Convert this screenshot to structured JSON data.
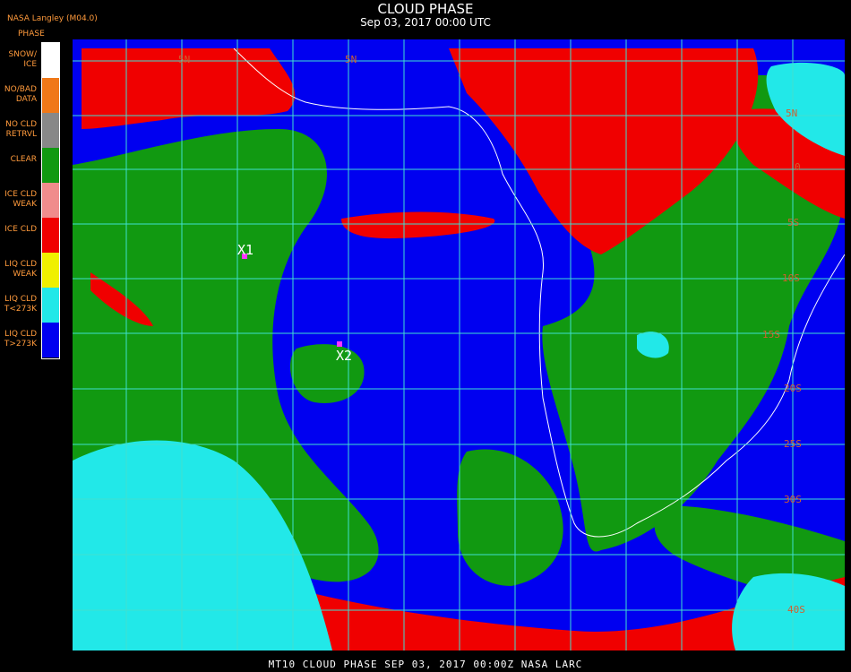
{
  "header": {
    "title": "CLOUD PHASE",
    "subtitle": "Sep 03, 2017 00:00 UTC",
    "producer": "NASA Langley (M04.0)"
  },
  "legend": {
    "title": "PHASE",
    "items": [
      {
        "label": "SNOW/\nICE",
        "color": "#ffffff"
      },
      {
        "label": "NO/BAD\nDATA",
        "color": "#f07818"
      },
      {
        "label": "NO CLD\nRETRVL",
        "color": "#888888"
      },
      {
        "label": "CLEAR",
        "color": "#119911"
      },
      {
        "label": "ICE CLD\nWEAK",
        "color": "#f08c8c"
      },
      {
        "label": "ICE CLD",
        "color": "#f00000"
      },
      {
        "label": "LIQ CLD\nWEAK",
        "color": "#f0f000"
      },
      {
        "label": "LIQ CLD\nT<273K",
        "color": "#22e8e8"
      },
      {
        "label": "LIQ CLD\nT>273K",
        "color": "#0000f0"
      }
    ]
  },
  "map": {
    "grid_color": "#40e0d0",
    "coast_color": "#ffffff",
    "markers": [
      {
        "label": "X1",
        "color": "#ff33ff"
      },
      {
        "label": "X2",
        "color": "#ff33ff"
      }
    ],
    "lat_labels": [
      "5N",
      "5N",
      "5N",
      "0",
      "5S",
      "10S",
      "15S",
      "20S",
      "25S",
      "30S",
      "40S"
    ]
  },
  "footer": {
    "text": "MT10  CLOUD PHASE   SEP 03, 2017 00:00Z  NASA LARC"
  }
}
